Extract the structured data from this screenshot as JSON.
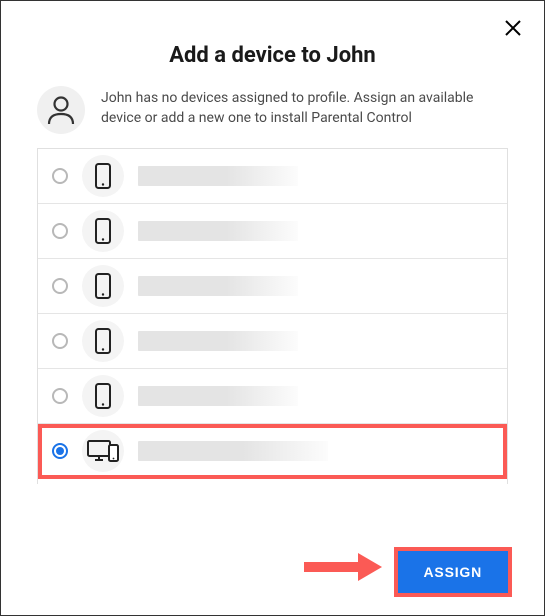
{
  "dialog": {
    "title": "Add a device to John",
    "description": "John has no devices assigned to profile. Assign an available device or add a new one to install Parental Control"
  },
  "devices": [
    {
      "type": "phone",
      "selected": false,
      "highlighted": false,
      "label": ""
    },
    {
      "type": "phone",
      "selected": false,
      "highlighted": false,
      "label": ""
    },
    {
      "type": "phone",
      "selected": false,
      "highlighted": false,
      "label": ""
    },
    {
      "type": "phone",
      "selected": false,
      "highlighted": false,
      "label": ""
    },
    {
      "type": "phone",
      "selected": false,
      "highlighted": false,
      "label": ""
    },
    {
      "type": "desktop",
      "selected": true,
      "highlighted": true,
      "label": ""
    }
  ],
  "buttons": {
    "assign": "ASSIGN"
  },
  "annotations": {
    "assign_highlighted": true,
    "arrow_to_assign": true
  },
  "colors": {
    "primary": "#1a73e8",
    "highlight": "#fb5a55"
  }
}
